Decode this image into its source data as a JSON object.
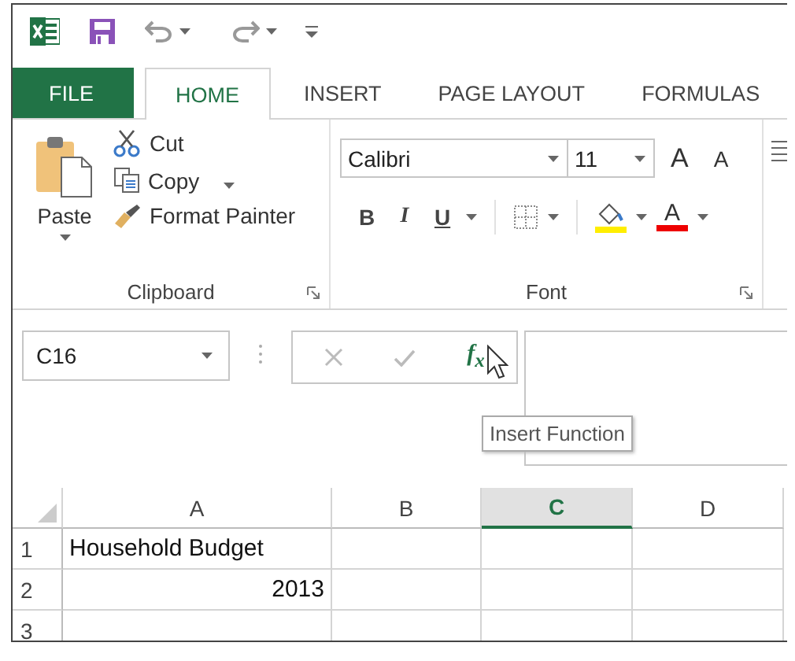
{
  "file_tab": "FILE",
  "tabs": [
    {
      "label": "HOME",
      "selected": true
    },
    {
      "label": "INSERT",
      "selected": false
    },
    {
      "label": "PAGE LAYOUT",
      "selected": false
    },
    {
      "label": "FORMULAS",
      "selected": false
    }
  ],
  "clipboard": {
    "paste": "Paste",
    "cut": "Cut",
    "copy": "Copy",
    "format_painter": "Format Painter",
    "label": "Clipboard"
  },
  "font": {
    "name": "Calibri",
    "size": "11",
    "grow": "A",
    "shrink": "A",
    "bold": "B",
    "italic": "I",
    "underline": "U",
    "font_color": "A",
    "label": "Font"
  },
  "formula_bar": {
    "name_box": "C16",
    "insert_function": "f$_{x}$",
    "tooltip": "Insert Function"
  },
  "sheet": {
    "columns": [
      {
        "label": "A",
        "selected": false
      },
      {
        "label": "B",
        "selected": false
      },
      {
        "label": "C",
        "selected": true
      },
      {
        "label": "D",
        "selected": false
      }
    ],
    "rows": [
      {
        "number": "1",
        "cells": [
          {
            "text": "Household Budget",
            "kind": "text"
          }
        ]
      },
      {
        "number": "2",
        "cells": [
          {
            "text": "2013",
            "kind": "number"
          }
        ]
      },
      {
        "number": "3",
        "cells": []
      }
    ]
  }
}
